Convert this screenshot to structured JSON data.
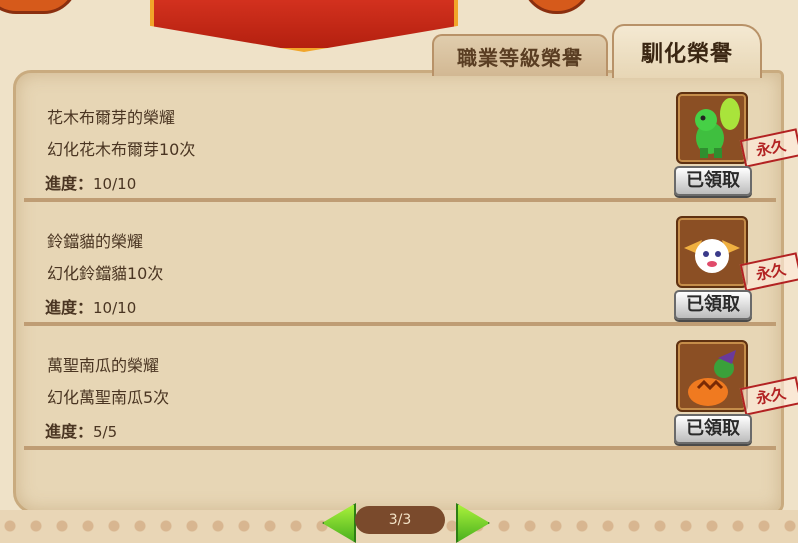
{
  "tabs": [
    {
      "label": "職業等級榮譽",
      "active": false
    },
    {
      "label": "馴化榮譽",
      "active": true
    }
  ],
  "items": [
    {
      "title": "花木布爾芽的榮耀",
      "desc": "幻化花木布爾芽10次",
      "progress_label": "進度：",
      "progress_value": "10/10",
      "claim_label": "已領取",
      "stamp": "永久",
      "pet_icon": "green-dragon-icon"
    },
    {
      "title": "鈴鐺貓的榮耀",
      "desc": "幻化鈴鐺貓10次",
      "progress_label": "進度：",
      "progress_value": "10/10",
      "claim_label": "已領取",
      "stamp": "永久",
      "pet_icon": "bell-cat-icon"
    },
    {
      "title": "萬聖南瓜的榮耀",
      "desc": "幻化萬聖南瓜5次",
      "progress_label": "進度：",
      "progress_value": "5/5",
      "claim_label": "已領取",
      "stamp": "永久",
      "pet_icon": "halloween-pumpkin-icon"
    }
  ],
  "pager": {
    "text": "3/3"
  },
  "colors": {
    "parchment": "#e7d6b5",
    "text": "#4a3522",
    "stamp": "#b22222",
    "arrow": "#6fd12a"
  }
}
